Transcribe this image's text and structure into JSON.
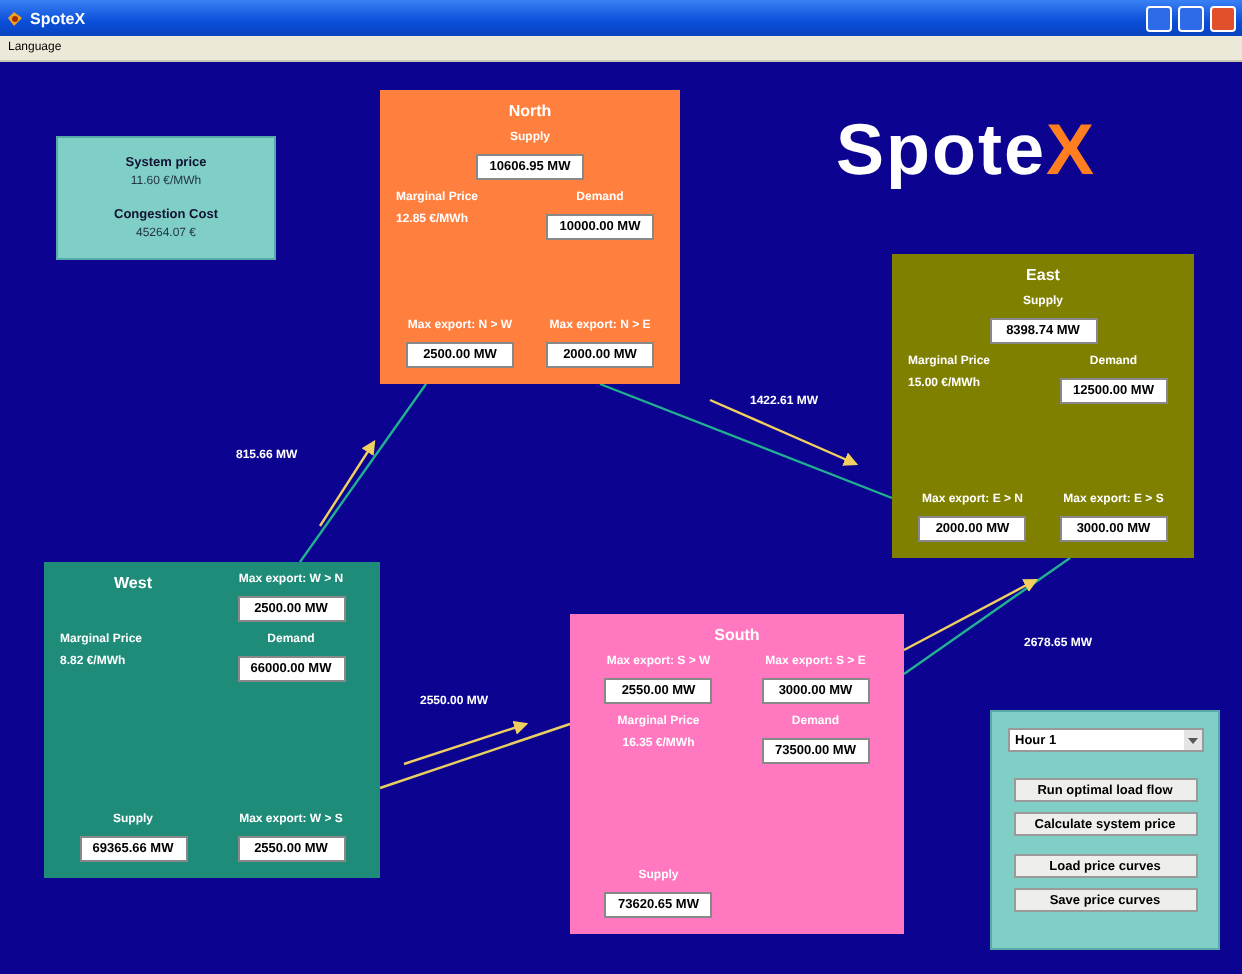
{
  "window": {
    "title": "SpoteX"
  },
  "menu": [
    "Language"
  ],
  "logo": {
    "text": "Spote",
    "accent": "X"
  },
  "summary": [
    {
      "label": "System price",
      "value": "11.60 €/MWh"
    },
    {
      "label": "Congestion Cost",
      "value": "45264.07 €"
    }
  ],
  "regions": [
    {
      "name": "North",
      "color": "#ff7f3f",
      "fields": [
        {
          "kind": "box",
          "label": "Supply",
          "value": "10606.95 MW"
        },
        {
          "kind": "text",
          "label": "Marginal Price",
          "value": "12.85 €/MWh"
        },
        {
          "kind": "box",
          "label": "Demand",
          "value": "10000.00 MW"
        },
        {
          "kind": "box",
          "label": "Max export: N > W",
          "value": "2500.00 MW"
        },
        {
          "kind": "box",
          "label": "Max export: N > E",
          "value": "2000.00 MW"
        }
      ]
    },
    {
      "name": "East",
      "color": "#808000",
      "fields": [
        {
          "kind": "box",
          "label": "Supply",
          "value": "8398.74 MW"
        },
        {
          "kind": "text",
          "label": "Marginal Price",
          "value": "15.00 €/MWh"
        },
        {
          "kind": "box",
          "label": "Demand",
          "value": "12500.00 MW"
        },
        {
          "kind": "box",
          "label": "Max export: E > N",
          "value": "2000.00 MW"
        },
        {
          "kind": "box",
          "label": "Max export: E > S",
          "value": "3000.00 MW"
        }
      ]
    },
    {
      "name": "West",
      "color": "#1e8c78",
      "fields": [
        {
          "kind": "box",
          "label": "Max export: W > N",
          "value": "2500.00 MW"
        },
        {
          "kind": "text",
          "label": "Marginal Price",
          "value": "8.82 €/MWh"
        },
        {
          "kind": "box",
          "label": "Demand",
          "value": "66000.00 MW"
        },
        {
          "kind": "box",
          "label": "Supply",
          "value": "69365.66 MW"
        },
        {
          "kind": "box",
          "label": "Max export: W > S",
          "value": "2550.00 MW"
        }
      ]
    },
    {
      "name": "South",
      "color": "#ff78c0",
      "fields": [
        {
          "kind": "box",
          "label": "Max export: S > W",
          "value": "2550.00 MW"
        },
        {
          "kind": "box",
          "label": "Max export: S > E",
          "value": "3000.00 MW"
        },
        {
          "kind": "text",
          "label": "Marginal Price",
          "value": "16.35 €/MWh"
        },
        {
          "kind": "box",
          "label": "Demand",
          "value": "73500.00 MW"
        },
        {
          "kind": "box",
          "label": "Supply",
          "value": "73620.65 MW"
        }
      ]
    }
  ],
  "flows": [
    "815.66 MW",
    "1422.61 MW",
    "2550.00 MW",
    "2678.65 MW"
  ],
  "controls": {
    "hour": "Hour 1",
    "buttons": [
      "Run optimal load flow",
      "Calculate system price",
      "Load price curves",
      "Save price curves"
    ]
  }
}
